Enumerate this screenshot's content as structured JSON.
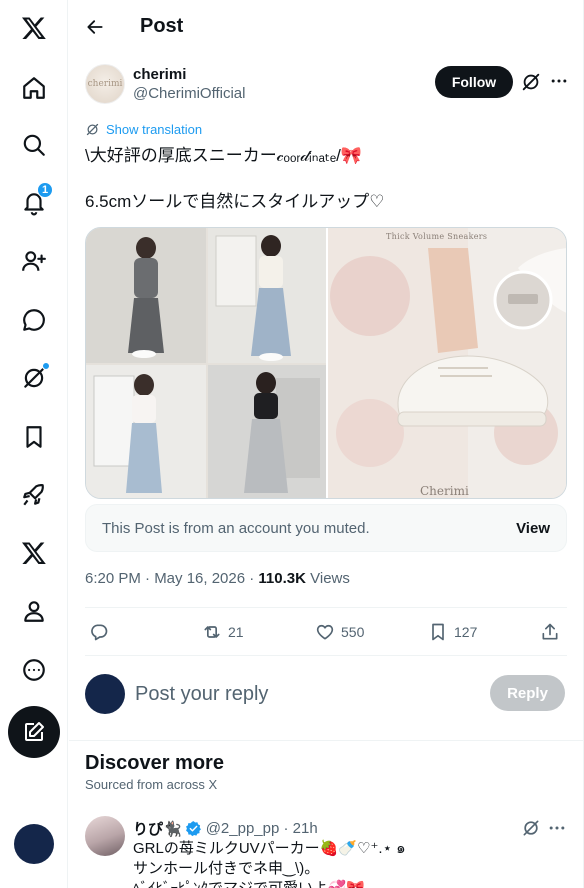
{
  "nav": {
    "notifications_badge": "1"
  },
  "header": {
    "title": "Post"
  },
  "post": {
    "display_name": "cherimi",
    "handle": "@CherimiOfficial",
    "avatar_text": "cherimi",
    "follow_label": "Follow",
    "translate_label": "Show translation",
    "text_line1": "\\大好評の厚底スニーカー𝒸ₒₒᵣ𝒹ᵢₙₐₜₑ/🎀",
    "text_line2": "6.5cmソールで自然にスタイルアップ♡",
    "media_heading": "Thick Volume Sneakers",
    "media_brand": "Cherimi",
    "muted_notice": "This Post is from an account you muted.",
    "muted_view": "View",
    "time": "6:20 PM · May 16, 2026 · ",
    "views_count": "110.3K",
    "views_label": " Views",
    "retweets": "21",
    "likes": "550",
    "bookmarks": "127"
  },
  "reply": {
    "placeholder": "Post your reply",
    "button": "Reply"
  },
  "discover": {
    "title": "Discover more",
    "subtitle": "Sourced from across X",
    "item": {
      "name": "りぴ🐈‍⬛",
      "handle": "@2_pp_pp · 21h",
      "line1": "GRLの苺ミルクUVパーカー🍓🍼♡⁺.⋆ ๑",
      "line2": "サンホール付きでネ申‿\\)。",
      "line3": "ﾍﾞｲﾋﾞｰﾋﾟﾝｸでマジで可愛いよ💞🎀"
    }
  },
  "colors": {
    "accent": "#1d9bf0",
    "text": "#0f1419",
    "muted_text": "#536471",
    "border": "#eff3f4"
  }
}
